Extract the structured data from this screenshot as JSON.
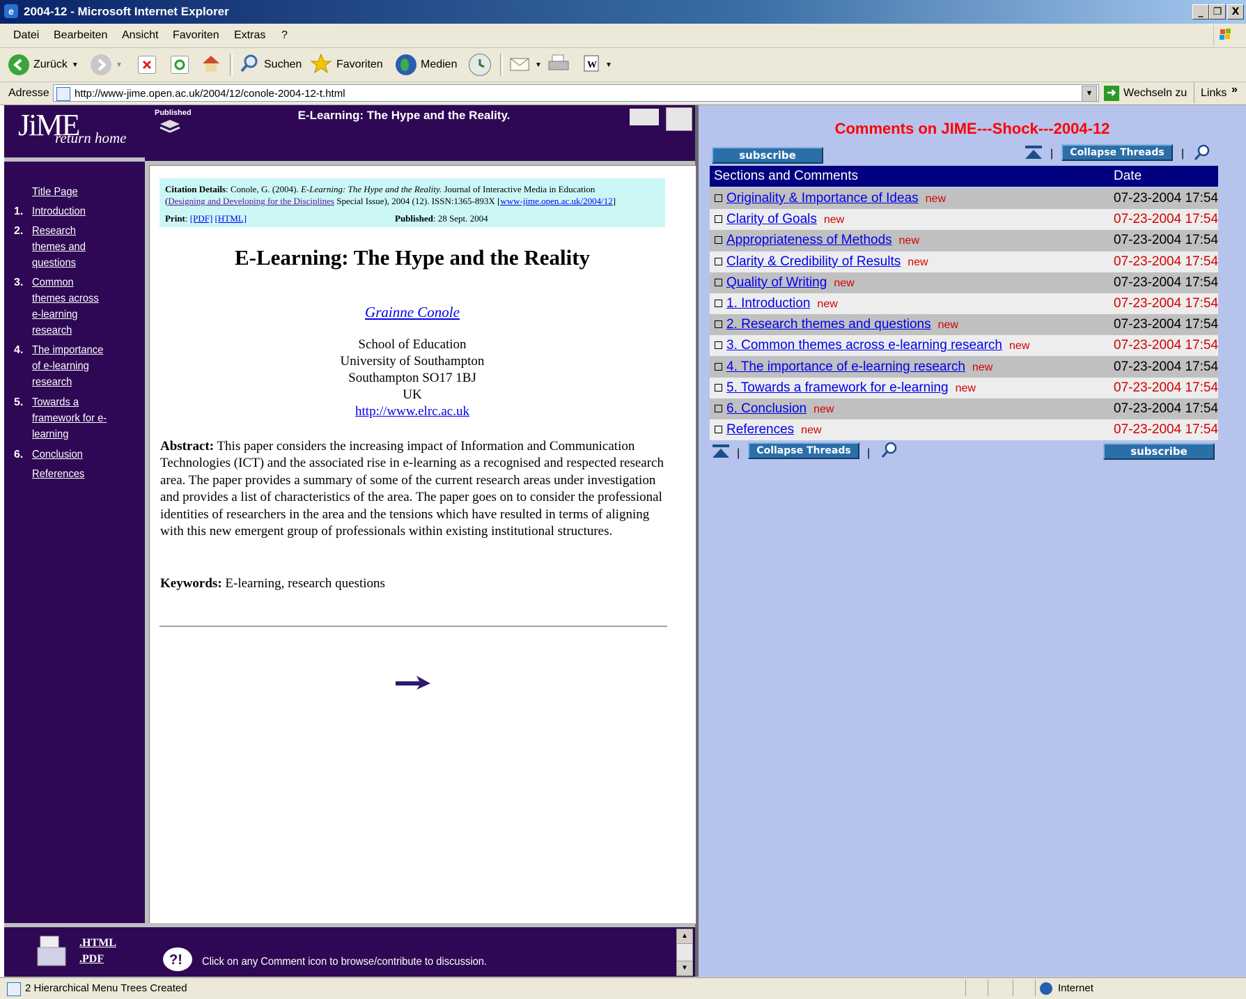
{
  "window": {
    "title": "2004-12 - Microsoft Internet Explorer",
    "controls": [
      "_",
      "¶",
      "X"
    ]
  },
  "menu": [
    "Datei",
    "Bearbeiten",
    "Ansicht",
    "Favoriten",
    "Extras",
    "?"
  ],
  "toolbar": {
    "back": "Zurück",
    "search": "Suchen",
    "favorites": "Favoriten",
    "media": "Medien"
  },
  "address": {
    "label": "Adresse",
    "url": "http://www-jime.open.ac.uk/2004/12/conole-2004-12-t.html",
    "go": "Wechseln zu",
    "links": "Links",
    "links_more": "»"
  },
  "jime": {
    "logo": "JiME",
    "logo_sub": "return home",
    "published_badge": "Published",
    "header_title": "E-Learning: The Hype and the Reality.",
    "nav": [
      {
        "num": "",
        "label": "Title Page"
      },
      {
        "num": "1.",
        "label": "Introduction"
      },
      {
        "num": "2.",
        "label": "Research themes and questions"
      },
      {
        "num": "3.",
        "label": "Common themes across e-learning research"
      },
      {
        "num": "4.",
        "label": "The importance of e-learning research"
      },
      {
        "num": "5.",
        "label": "Towards a framework for e-learning"
      },
      {
        "num": "6.",
        "label": "Conclusion"
      },
      {
        "num": "",
        "label": "References"
      }
    ],
    "bottom_links": [
      ".HTML",
      ".PDF"
    ],
    "bottom_hint": "Click on any Comment icon to browse/contribute to discussion."
  },
  "citation": {
    "label": "Citation Details",
    "authors": ": Conole, G. (2004). ",
    "title_italic": "E-Learning: The Hype and the Reality.",
    "journal": " Journal of Interactive Media in Education",
    "open_paren": "(",
    "special_issue_link": "Designing and Developing for the Disciplines",
    "issue": " Special Issue), 2004 (12). ISSN:1365-893X [",
    "url_link": "www-jime.open.ac.uk/2004/12",
    "close_bracket": "]",
    "print_label": "Print",
    "print_sep": ": ",
    "pdf": "[PDF]",
    "html": "[HTML]",
    "published_label": "Published",
    "published_date": ": 28 Sept. 2004"
  },
  "paper": {
    "title": "E-Learning: The Hype and the Reality",
    "author": "Grainne Conole",
    "affiliation": [
      "School of Education",
      "University of Southampton",
      "Southampton SO17 1BJ",
      "UK"
    ],
    "website": "http://www.elrc.ac.uk",
    "abstract_label": "Abstract:",
    "abstract": " This paper considers the increasing impact of Information and Communication Technologies (ICT) and the associated rise in e-learning as a recognised and respected research area. The paper provides a summary of some of the current research areas under investigation and provides a list of characteristics of the area. The paper goes on to consider the professional identities of researchers in the area and the tensions which have resulted in terms of aligning with this new emergent group of professionals within existing institutional structures.",
    "keywords_label": "Keywords:",
    "keywords": " E-learning, research questions"
  },
  "comments": {
    "heading": "Comments on JIME---Shock---2004-12",
    "subscribe": "subscribe",
    "collapse": "Collapse Threads",
    "col_sections": "Sections and Comments",
    "col_date": "Date",
    "new_label": "new",
    "rows": [
      {
        "title": "Originality & Importance of Ideas",
        "date": "07-23-2004 17:54"
      },
      {
        "title": "Clarity of Goals",
        "date": "07-23-2004 17:54"
      },
      {
        "title": "Appropriateness of Methods",
        "date": "07-23-2004 17:54"
      },
      {
        "title": "Clarity & Credibility of Results",
        "date": "07-23-2004 17:54"
      },
      {
        "title": "Quality of Writing",
        "date": "07-23-2004 17:54"
      },
      {
        "title": "1. Introduction",
        "date": "07-23-2004 17:54"
      },
      {
        "title": "2. Research themes and questions",
        "date": "07-23-2004 17:54"
      },
      {
        "title": "3. Common themes across e-learning research",
        "date": "07-23-2004 17:54"
      },
      {
        "title": "4. The importance of e-learning research",
        "date": "07-23-2004 17:54"
      },
      {
        "title": "5. Towards a framework for e-learning",
        "date": "07-23-2004 17:54"
      },
      {
        "title": "6. Conclusion",
        "date": "07-23-2004 17:54"
      },
      {
        "title": " References",
        "date": "07-23-2004 17:54"
      }
    ]
  },
  "status": {
    "text": "2 Hierarchical Menu Trees Created",
    "zone": "Internet"
  },
  "colors": {
    "jime_purple": "#2e0854",
    "comments_bg": "#b6c3ed",
    "comments_header": "#000080",
    "heading_red": "#ff0000",
    "row_dark": "#c0c0c0",
    "row_light": "#ededed"
  }
}
